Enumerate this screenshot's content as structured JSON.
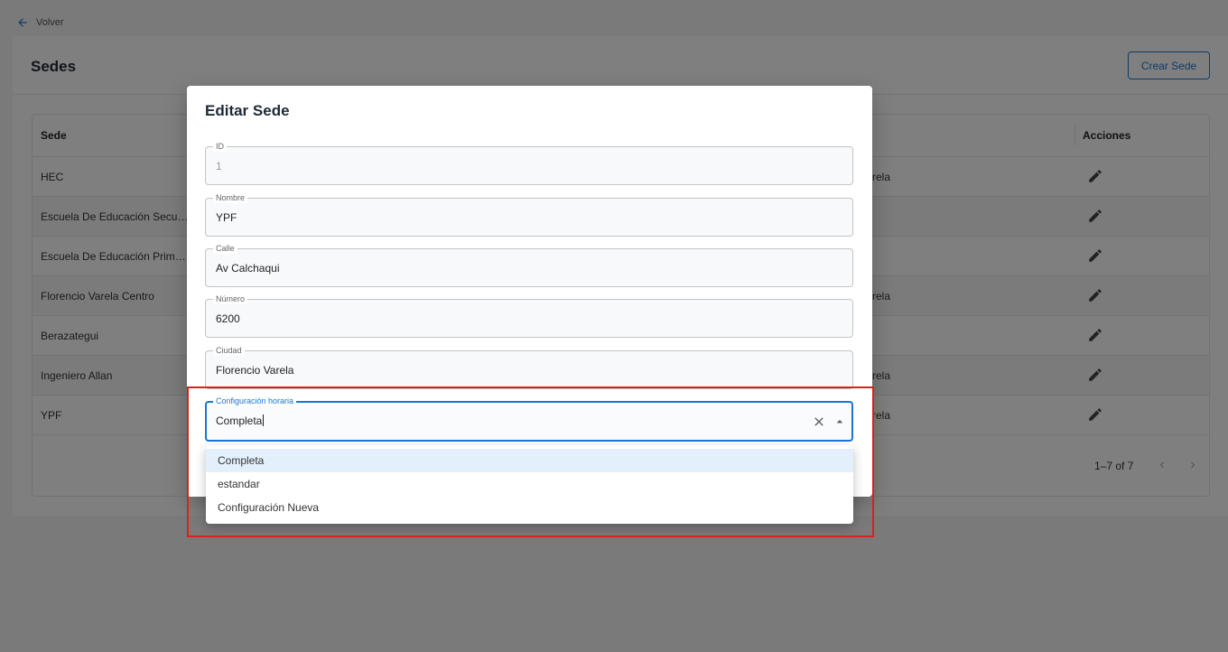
{
  "back": {
    "label": "Volver"
  },
  "page": {
    "title": "Sedes",
    "create_button": "Crear Sede"
  },
  "table": {
    "headers": {
      "sede": "Sede",
      "acciones": "Acciones"
    },
    "rows": [
      {
        "sede": "HEC",
        "city_partial": "rela"
      },
      {
        "sede": "Escuela De Educación Secun...",
        "city_partial": ""
      },
      {
        "sede": "Escuela De Educación Primar...",
        "city_partial": ""
      },
      {
        "sede": "Florencio Varela Centro",
        "city_partial": "rela"
      },
      {
        "sede": "Berazategui",
        "city_partial": ""
      },
      {
        "sede": "Ingeniero Allan",
        "city_partial": "rela"
      },
      {
        "sede": "YPF",
        "city_partial": "rela"
      }
    ],
    "pagination": "1–7 of 7"
  },
  "dialog": {
    "title": "Editar Sede",
    "fields": {
      "id": {
        "label": "ID",
        "value": "1"
      },
      "nombre": {
        "label": "Nombre",
        "value": "YPF"
      },
      "calle": {
        "label": "Calle",
        "value": "Av Calchaqui"
      },
      "numero": {
        "label": "Número",
        "value": "6200"
      },
      "ciudad": {
        "label": "Ciudad",
        "value": "Florencio Varela"
      },
      "config": {
        "label": "Configuración horaria",
        "value": "Completa"
      }
    },
    "options": [
      "Completa",
      "estandar",
      "Configuración Nueva"
    ],
    "selected_option": "Completa"
  },
  "colors": {
    "accent": "#1976d2",
    "highlight": "#e11d1d",
    "selected_option_bg": "#e3f0fb"
  },
  "icons": {
    "back": "arrow-left-icon",
    "edit": "pencil-icon",
    "clear": "close-icon",
    "dropdown": "arrow-up-icon",
    "prev": "chevron-left-icon",
    "next": "chevron-right-icon"
  }
}
